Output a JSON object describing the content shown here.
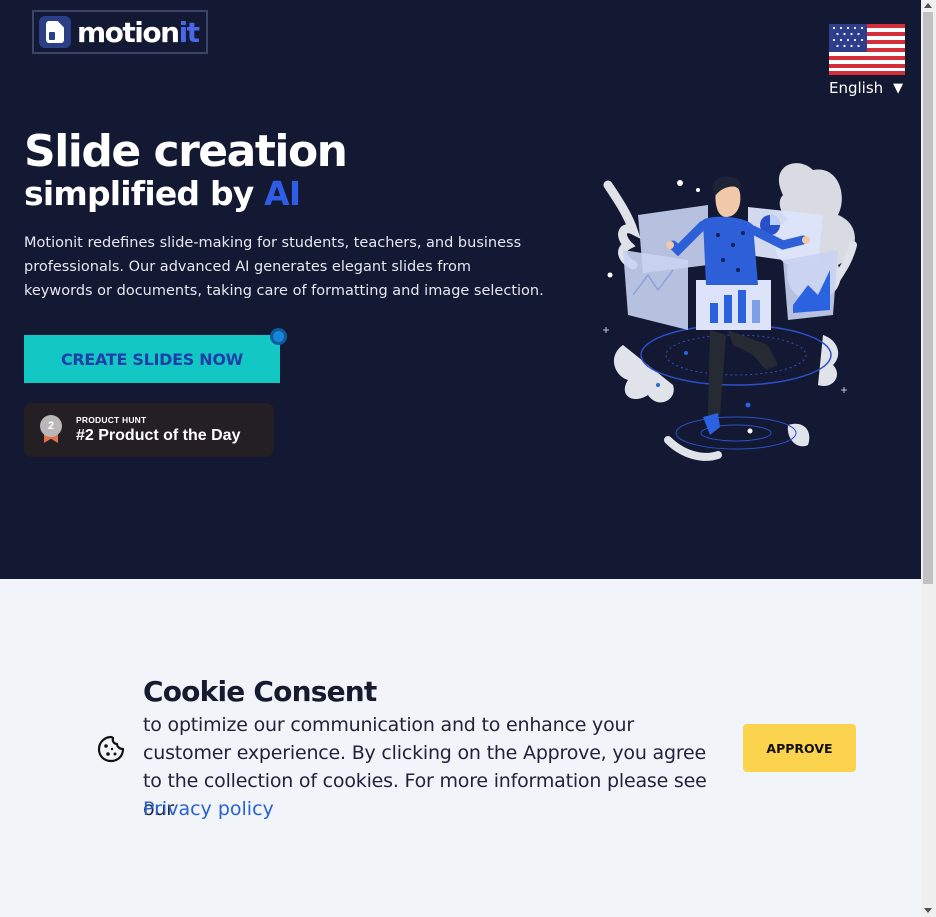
{
  "header": {
    "logo_text_white": "motion",
    "logo_text_blue": "it",
    "logo_icon": "motionit-logo-icon"
  },
  "language": {
    "selected": "English",
    "flag_icon": "us-flag-icon",
    "arrow": "▼"
  },
  "hero": {
    "title": "Slide creation",
    "subtitle_prefix": "simplified by ",
    "subtitle_highlight": "AI",
    "description": "Motionit redefines slide-making for students, teachers, and business professionals. Our advanced AI generates elegant slides from keywords or documents, taking care of formatting and image selection.",
    "cta_label": "CREATE SLIDES NOW",
    "illustration_icon": "person-with-slides-illustration"
  },
  "product_hunt": {
    "medal_number": "2",
    "label_small": "PRODUCT HUNT",
    "label_big": "#2 Product of the Day"
  },
  "cookie": {
    "title": "Cookie Consent",
    "text": "to optimize our communication and to enhance your customer experience. By clicking on the Approve, you agree to the collection of cookies. For more information please see our",
    "link": "Privacy policy",
    "approve_label": "APPROVE",
    "icon": "cookie-icon"
  },
  "colors": {
    "hero_bg": "#131833",
    "accent_blue": "#2f5de5",
    "cta_teal": "#13c8c4",
    "approve_yellow": "#fcd34d",
    "cookie_bg": "#f1f4f8"
  }
}
